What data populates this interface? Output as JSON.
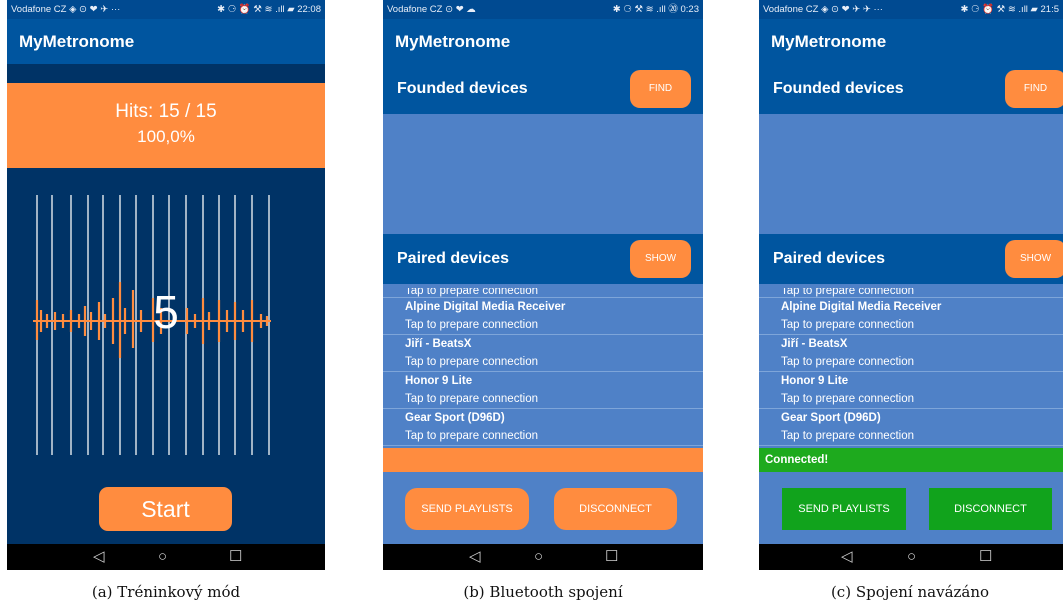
{
  "app_title": "MyMetronome",
  "colors": {
    "primary": "#00559f",
    "accent": "#ff8c3f",
    "success": "#11a31c",
    "list_bg": "#4f81c7",
    "dark_bg": "#003366"
  },
  "phone_a": {
    "status_left": "Vodafone CZ ◈ ⊙ ❤ ✈ ···",
    "status_right": "✱ ⚆ ⏰ ⚒ ≋ .ıll ▰ 22:08",
    "hits_text": "Hits: 15 / 15",
    "percent_text": "100,0%",
    "count": "5",
    "start_label": "Start",
    "caption": "(a) Tréninkový mód"
  },
  "phone_b": {
    "status_left": "Vodafone CZ ⊙ ❤ ☁",
    "status_right": "✱ ⚆ ⚒ ≋ .ıll ⑳ 0:23",
    "founded_title": "Founded devices",
    "find_label": "FIND",
    "paired_title": "Paired devices",
    "show_label": "SHOW",
    "status_text": "",
    "send_label": "SEND PLAYLISTS",
    "disconnect_label": "DISCONNECT",
    "caption": "(b) Bluetooth spojení"
  },
  "phone_c": {
    "status_left": "Vodafone CZ ◈ ⊙ ❤ ✈ ✈ ···",
    "status_right": "✱ ⚆ ⏰ ⚒ ≋ .ıll ▰ 21:5",
    "founded_title": "Founded devices",
    "find_label": "FIND",
    "paired_title": "Paired devices",
    "show_label": "SHOW",
    "status_text": "Connected!",
    "send_label": "SEND PLAYLISTS",
    "disconnect_label": "DISCONNECT",
    "caption": "(c) Spojení navázáno"
  },
  "devices": {
    "first_subtitle": "Tap to prepare connection",
    "items": [
      {
        "name": "Alpine Digital Media Receiver",
        "subtitle": "Tap to prepare connection"
      },
      {
        "name": "Jiří - BeatsX",
        "subtitle": "Tap to prepare connection"
      },
      {
        "name": "Honor 9 Lite",
        "subtitle": "Tap to prepare connection"
      },
      {
        "name": "Gear Sport (D96D)",
        "subtitle": "Tap to prepare connection"
      }
    ]
  },
  "nav_icons": [
    "back-icon",
    "home-icon",
    "recents-icon"
  ],
  "nav_glyphs": {
    "back": "◁",
    "home": "○",
    "recents": "☐"
  }
}
